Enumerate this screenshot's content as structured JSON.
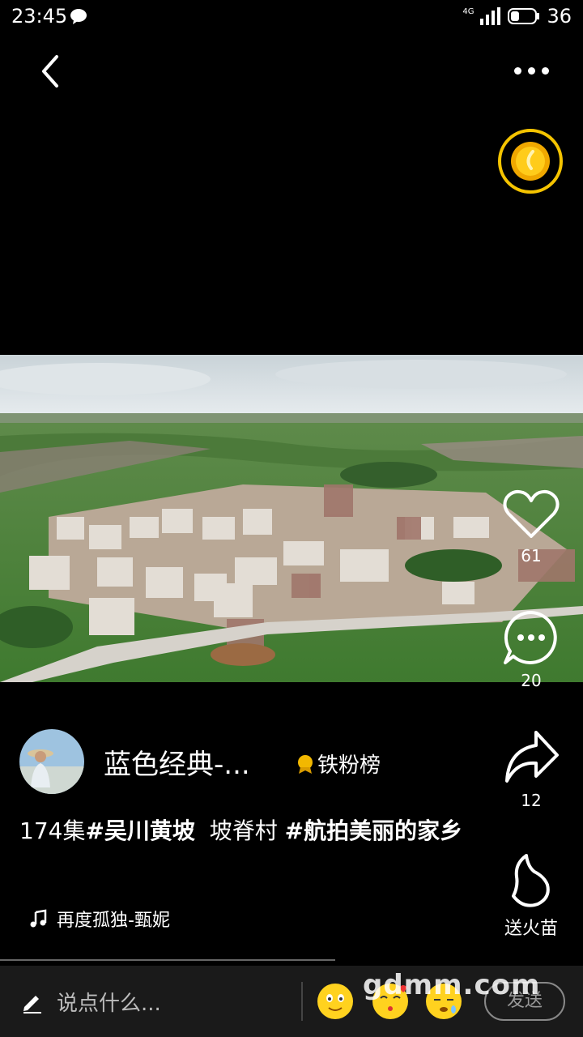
{
  "status": {
    "time": "23:45",
    "network": "4G",
    "battery": "36"
  },
  "video": {
    "likes": "61",
    "comments": "20",
    "shares": "12",
    "gift_label": "送火苗"
  },
  "author": {
    "name": "蓝色经典-...",
    "rank": "铁粉榜"
  },
  "caption": {
    "episode": "174集",
    "tag1": "#吴川黄坡",
    "place": "坡脊村",
    "tag2": "#航拍美丽的家乡"
  },
  "music": {
    "title": "再度孤独-甄妮"
  },
  "input": {
    "placeholder": "说点什么...",
    "send": "发送"
  },
  "watermark": "gdmm.com"
}
